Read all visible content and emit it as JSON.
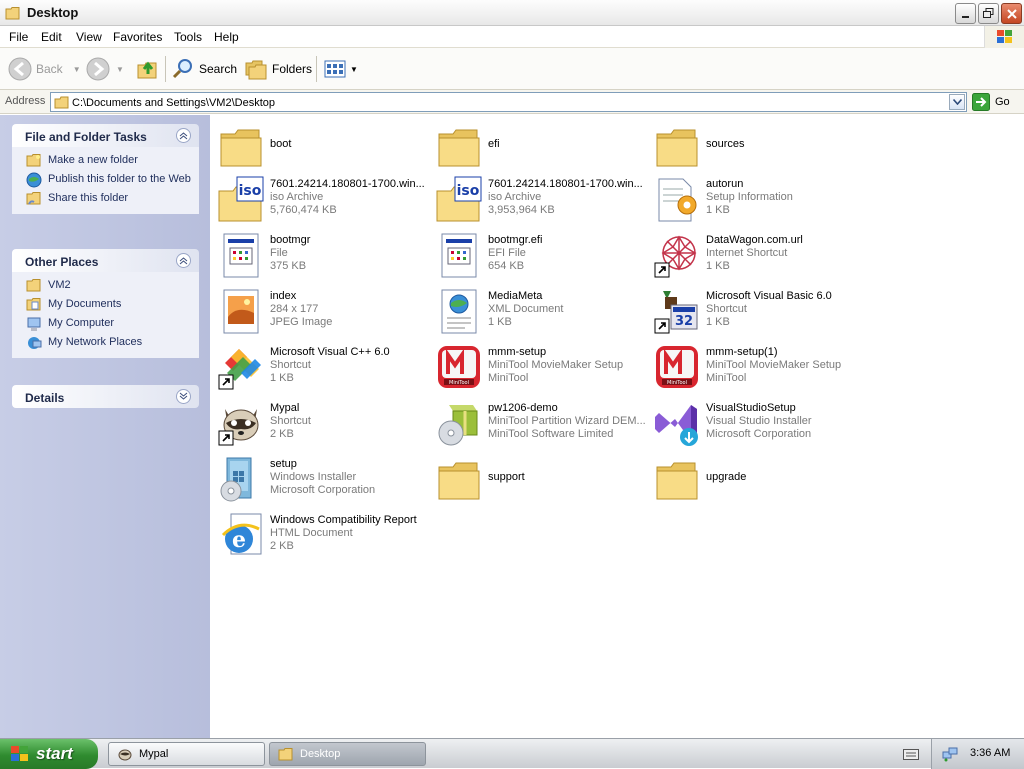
{
  "window": {
    "title": "Desktop"
  },
  "menu": [
    "File",
    "Edit",
    "View",
    "Favorites",
    "Tools",
    "Help"
  ],
  "toolbar": {
    "back": "Back",
    "search": "Search",
    "folders": "Folders"
  },
  "address": {
    "label": "Address",
    "path": "C:\\Documents and Settings\\VM2\\Desktop",
    "go": "Go"
  },
  "left_pane": {
    "tasks": {
      "title": "File and Folder Tasks",
      "items": [
        "Make a new folder",
        "Publish this folder to the Web",
        "Share this folder"
      ]
    },
    "places": {
      "title": "Other Places",
      "items": [
        "VM2",
        "My Documents",
        "My Computer",
        "My Network Places"
      ]
    },
    "details": {
      "title": "Details"
    }
  },
  "items": [
    {
      "name": "boot",
      "d1": "",
      "d2": "",
      "icon": "folder-icon"
    },
    {
      "name": "efi",
      "d1": "",
      "d2": "",
      "icon": "folder-icon"
    },
    {
      "name": "sources",
      "d1": "",
      "d2": "",
      "icon": "folder-icon"
    },
    {
      "name": "7601.24214.180801-1700.win...",
      "d1": "iso Archive",
      "d2": "5,760,474 KB",
      "icon": "iso-archive-icon"
    },
    {
      "name": "7601.24214.180801-1700.win...",
      "d1": "iso Archive",
      "d2": "3,953,964 KB",
      "icon": "iso-archive-icon"
    },
    {
      "name": "autorun",
      "d1": "Setup Information",
      "d2": "1 KB",
      "icon": "setup-info-icon"
    },
    {
      "name": "bootmgr",
      "d1": "File",
      "d2": "375 KB",
      "icon": "system-file-icon"
    },
    {
      "name": "bootmgr.efi",
      "d1": "EFI File",
      "d2": "654 KB",
      "icon": "system-file-icon"
    },
    {
      "name": "DataWagon.com.url",
      "d1": "Internet Shortcut",
      "d2": "1 KB",
      "icon": "internet-shortcut-icon"
    },
    {
      "name": "index",
      "d1": "284 x 177",
      "d2": "JPEG Image",
      "icon": "jpeg-image-icon"
    },
    {
      "name": "MediaMeta",
      "d1": "XML Document",
      "d2": "1 KB",
      "icon": "xml-document-icon"
    },
    {
      "name": "Microsoft Visual Basic 6.0",
      "d1": "Shortcut",
      "d2": "1 KB",
      "icon": "visual-basic-icon"
    },
    {
      "name": "Microsoft Visual C++ 6.0",
      "d1": "Shortcut",
      "d2": "1 KB",
      "icon": "visual-cpp-icon"
    },
    {
      "name": "mmm-setup",
      "d1": "MiniTool MovieMaker Setup",
      "d2": "MiniTool",
      "icon": "minitool-moviemaker-icon"
    },
    {
      "name": "mmm-setup(1)",
      "d1": "MiniTool MovieMaker Setup",
      "d2": "MiniTool",
      "icon": "minitool-moviemaker-icon"
    },
    {
      "name": "Mypal",
      "d1": "Shortcut",
      "d2": "2 KB",
      "icon": "mypal-raccoon-icon"
    },
    {
      "name": "pw1206-demo",
      "d1": "MiniTool Partition Wizard DEM...",
      "d2": "MiniTool Software Limited",
      "icon": "installer-box-icon"
    },
    {
      "name": "VisualStudioSetup",
      "d1": "Visual Studio Installer",
      "d2": "Microsoft Corporation",
      "icon": "visual-studio-icon"
    },
    {
      "name": "setup",
      "d1": "Windows Installer",
      "d2": "Microsoft Corporation",
      "icon": "windows-installer-icon"
    },
    {
      "name": "support",
      "d1": "",
      "d2": "",
      "icon": "folder-icon"
    },
    {
      "name": "upgrade",
      "d1": "",
      "d2": "",
      "icon": "folder-icon"
    },
    {
      "name": "Windows Compatibility Report",
      "d1": "HTML Document",
      "d2": "2 KB",
      "icon": "ie-html-document-icon"
    }
  ],
  "taskbar": {
    "start": "start",
    "tasks": [
      {
        "label": "Mypal"
      },
      {
        "label": "Desktop"
      }
    ],
    "clock": "3:36 AM"
  }
}
